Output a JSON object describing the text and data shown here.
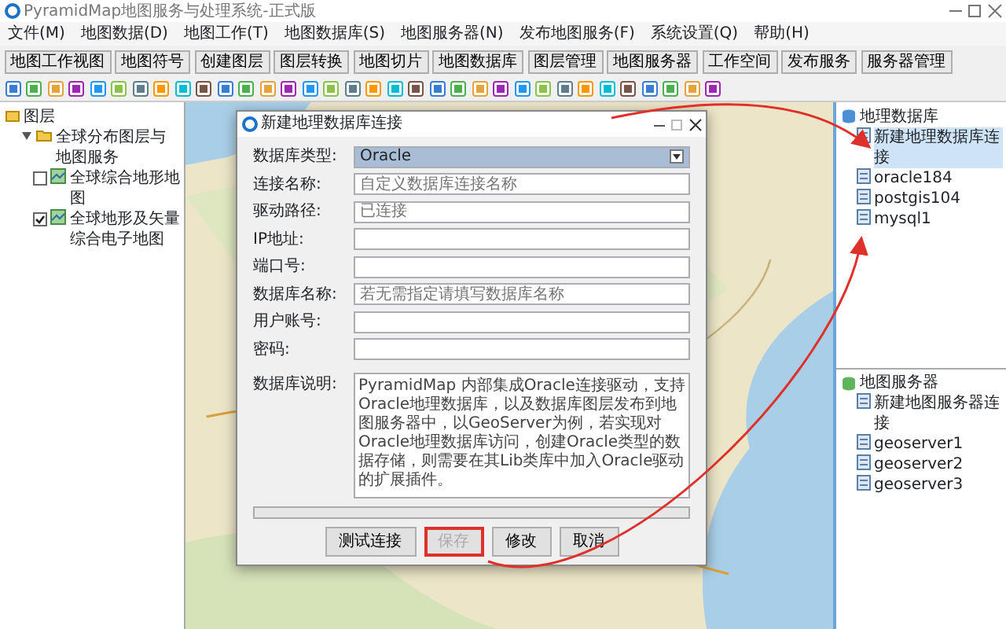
{
  "window": {
    "title": "PyramidMap地图服务与处理系统-正式版"
  },
  "menu": [
    "文件(M)",
    "地图数据(D)",
    "地图工作(T)",
    "地图数据库(S)",
    "地图服务器(N)",
    "发布地图服务(F)",
    "系统设置(Q)",
    "帮助(H)"
  ],
  "toolbar_buttons": [
    "地图工作视图",
    "地图符号",
    "创建图层",
    "图层转换",
    "地图切片",
    "地图数据库",
    "图层管理",
    "地图服务器",
    "工作空间",
    "发布服务",
    "服务器管理"
  ],
  "layers_panel": {
    "title": "图层",
    "tree": [
      {
        "label": "全球分布图层与地图服务",
        "expanded": true,
        "children": [
          {
            "label": "全球综合地形地图",
            "checked": false
          },
          {
            "label": "全球地形及矢量综合电子地图",
            "checked": true
          }
        ]
      }
    ]
  },
  "geodatabase_panel": {
    "title": "地理数据库",
    "items": [
      {
        "label": "新建地理数据库连接",
        "selected": true
      },
      {
        "label": "oracle184",
        "selected": false
      },
      {
        "label": "postgis104",
        "selected": false
      },
      {
        "label": "mysql1",
        "selected": false
      }
    ]
  },
  "map_server_panel": {
    "title": "地图服务器",
    "items": [
      {
        "label": "新建地图服务器连接"
      },
      {
        "label": "geoserver1"
      },
      {
        "label": "geoserver2"
      },
      {
        "label": "geoserver3"
      }
    ]
  },
  "dialog": {
    "title": "新建地理数据库连接",
    "fields": [
      {
        "kind": "select",
        "label": "数据库类型:",
        "value": "Oracle"
      },
      {
        "kind": "text",
        "label": "连接名称:",
        "placeholder": "自定义数据库连接名称"
      },
      {
        "kind": "text",
        "label": "驱动路径:",
        "placeholder": "已连接"
      },
      {
        "kind": "text",
        "label": "IP地址:"
      },
      {
        "kind": "text",
        "label": "端口号:"
      },
      {
        "kind": "text",
        "label": "数据库名称:",
        "placeholder": "若无需指定请填写数据库名称"
      },
      {
        "kind": "text",
        "label": "用户账号:"
      },
      {
        "kind": "password",
        "label": "密码:"
      }
    ],
    "description": {
      "label": "数据库说明:",
      "text": "PyramidMap 内部集成Oracle连接驱动，支持Oracle地理数据库，以及数据库图层发布到地图服务器中，以GeoServer为例，若实现对Oracle地理数据库访问，创建Oracle类型的数据存储，则需要在其Lib类库中加入Oracle驱动的扩展插件。"
    },
    "progress": {
      "level": 0
    },
    "buttons": [
      {
        "label": "测试连接",
        "disabled": false,
        "highlighted": false
      },
      {
        "label": "保存",
        "disabled": true,
        "highlighted": true
      },
      {
        "label": "修改",
        "disabled": false,
        "highlighted": false
      },
      {
        "label": "取消",
        "disabled": false,
        "highlighted": false
      }
    ]
  }
}
